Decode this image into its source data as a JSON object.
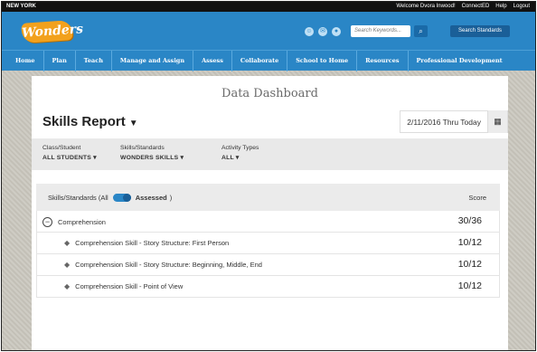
{
  "topbar": {
    "region": "NEW YORK",
    "links": [
      "Welcome Dvora Inwood!",
      "ConnectED",
      "Help",
      "Logout"
    ]
  },
  "header": {
    "logo": "Wonders",
    "search_placeholder": "Search Keywords...",
    "search_standards_label": "Search Standards"
  },
  "nav": {
    "items": [
      "Home",
      "Plan",
      "Teach",
      "Manage and Assign",
      "Assess",
      "Collaborate",
      "School to Home",
      "Resources",
      "Professional Development"
    ]
  },
  "dashboard": {
    "title": "Data Dashboard",
    "report_title": "Skills Report",
    "date_range": "2/11/2016 Thru Today"
  },
  "filters": [
    {
      "label": "Class/Student",
      "value": "ALL STUDENTS"
    },
    {
      "label": "Skills/Standards",
      "value": "WONDERS SKILLS"
    },
    {
      "label": "Activity Types",
      "value": "ALL"
    }
  ],
  "table": {
    "header_left_prefix": "Skills/Standards (All",
    "header_assessed": "Assessed",
    "header_suffix": ")",
    "header_score": "Score",
    "toggle_on": true,
    "group": {
      "name": "Comprehension",
      "score": "30/36"
    },
    "rows": [
      {
        "name": "Comprehension Skill - Story Structure: First Person",
        "score": "10/12"
      },
      {
        "name": "Comprehension Skill - Story Structure: Beginning, Middle, End",
        "score": "10/12"
      },
      {
        "name": "Comprehension Skill - Point of View",
        "score": "10/12"
      }
    ]
  },
  "colors": {
    "header_blue": "#2a86c6",
    "logo_orange": "#f2a11d",
    "toggle_blue": "#2a86c6"
  }
}
